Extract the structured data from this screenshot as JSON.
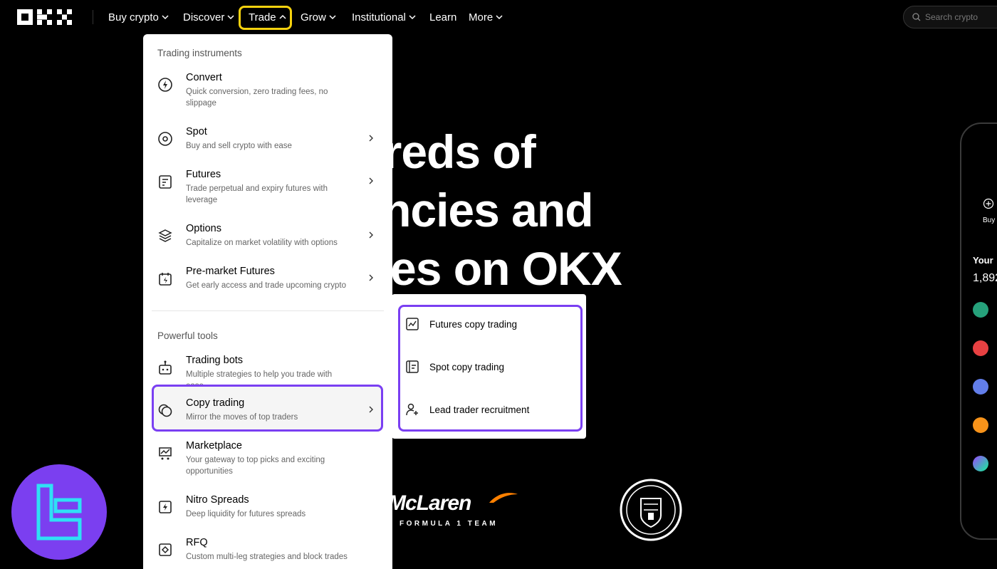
{
  "nav": {
    "items": [
      {
        "label": "Buy crypto",
        "chevron": true
      },
      {
        "label": "Discover",
        "chevron": true
      },
      {
        "label": "Trade",
        "chevron": true,
        "active": true
      },
      {
        "label": "Grow",
        "chevron": true
      },
      {
        "label": "Institutional",
        "chevron": true
      },
      {
        "label": "Learn",
        "chevron": false
      },
      {
        "label": "More",
        "chevron": true
      }
    ],
    "search_placeholder": "Search crypto"
  },
  "hero": {
    "line1": "ndreds of",
    "line2": "rrencies and",
    "line3": "es on OKX"
  },
  "dropdown": {
    "section1_title": "Trading instruments",
    "instruments": [
      {
        "title": "Convert",
        "desc": "Quick conversion, zero trading fees, no slippage",
        "icon": "convert-icon",
        "chevron": false
      },
      {
        "title": "Spot",
        "desc": "Buy and sell crypto with ease",
        "icon": "spot-icon",
        "chevron": true
      },
      {
        "title": "Futures",
        "desc": "Trade perpetual and expiry futures with leverage",
        "icon": "futures-icon",
        "chevron": true
      },
      {
        "title": "Options",
        "desc": "Capitalize on market volatility with options",
        "icon": "options-icon",
        "chevron": true
      },
      {
        "title": "Pre-market Futures",
        "desc": "Get early access and trade upcoming crypto",
        "icon": "premarket-icon",
        "chevron": true
      }
    ],
    "section2_title": "Powerful tools",
    "tools": [
      {
        "title": "Trading bots",
        "desc": "Multiple strategies to help you trade with ease",
        "icon": "bot-icon",
        "chevron": false
      },
      {
        "title": "Copy trading",
        "desc": "Mirror the moves of top traders",
        "icon": "copy-trading-icon",
        "chevron": true
      },
      {
        "title": "Marketplace",
        "desc": "Your gateway to top picks and exciting opportunities",
        "icon": "marketplace-icon",
        "chevron": false
      },
      {
        "title": "Nitro Spreads",
        "desc": "Deep liquidity for futures spreads",
        "icon": "nitro-icon",
        "chevron": false
      },
      {
        "title": "RFQ",
        "desc": "Custom multi-leg strategies and block trades",
        "icon": "rfq-icon",
        "chevron": false
      }
    ]
  },
  "submenu": {
    "items": [
      {
        "label": "Futures copy trading",
        "icon": "futures-copy-icon"
      },
      {
        "label": "Spot copy trading",
        "icon": "spot-copy-icon"
      },
      {
        "label": "Lead trader recruitment",
        "icon": "lead-trader-icon"
      }
    ]
  },
  "brands": {
    "mclaren_name": "McLaren",
    "mclaren_sub": "FORMULA 1 TEAM"
  },
  "phone": {
    "buy_label": "Buy",
    "your_label": "Your",
    "balance": "1,892"
  },
  "colors": {
    "highlight_yellow": "#f6d20e",
    "highlight_purple": "#7a3ff2"
  }
}
